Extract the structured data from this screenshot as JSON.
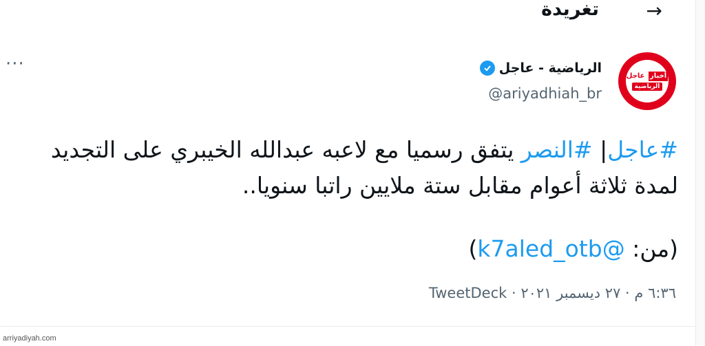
{
  "header": {
    "title": "تغريدة"
  },
  "author": {
    "avatar_top": "عاجل",
    "avatar_box": "أخبار",
    "avatar_bottom": "الرياضية",
    "name": "الرياضية - عاجل",
    "handle": "@ariyadhiah_br",
    "verified": true
  },
  "tweet": {
    "hashtag1": "#عاجل",
    "separator": "| ",
    "hashtag2": "#النصر",
    "text_line1": " يتفق رسميا مع لاعبه عبدالله الخيبري على التجديد لمدة ثلاثة أعوام مقابل ستة ملايين راتبا سنويا..",
    "source_prefix": "(من: ",
    "source_mention": "@k7aled_otb",
    "source_suffix": ")"
  },
  "meta": {
    "time": "٦:٣٦ م",
    "dot1": " · ",
    "date": "٢٧ ديسمبر ٢٠٢١",
    "dot2": " · ",
    "app": "TweetDeck"
  },
  "watermark": "arriyadiyah.com",
  "colors": {
    "link": "#1d9bf0",
    "secondary": "#536471",
    "brand": "#e0001b"
  },
  "icons": {
    "back": "arrow-right-icon",
    "more": "more-horizontal-icon",
    "verified": "verified-badge-icon"
  }
}
